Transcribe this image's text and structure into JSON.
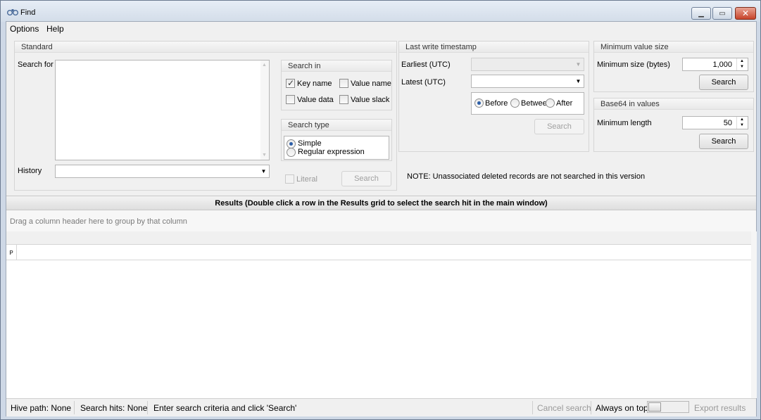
{
  "window": {
    "title": "Find"
  },
  "menu": {
    "items": [
      "Options",
      "Help"
    ]
  },
  "standard": {
    "title": "Standard",
    "search_for_label": "Search for",
    "search_for_value": "",
    "history_label": "History",
    "history_value": "",
    "search_in": {
      "title": "Search in",
      "key_name": {
        "label": "Key name",
        "checked": true
      },
      "value_name": {
        "label": "Value name",
        "checked": false
      },
      "value_data": {
        "label": "Value data",
        "checked": false
      },
      "value_slack": {
        "label": "Value slack",
        "checked": false
      }
    },
    "search_type": {
      "title": "Search type",
      "simple": "Simple",
      "regex": "Regular expression",
      "selected": "Simple"
    },
    "literal_label": "Literal",
    "search_button": "Search"
  },
  "timestamp": {
    "title": "Last write timestamp",
    "earliest_label": "Earliest (UTC)",
    "earliest_value": "",
    "latest_label": "Latest (UTC)",
    "latest_value": "",
    "before": "Before",
    "between": "Betwee",
    "after": "After",
    "selected": "Before",
    "search_button": "Search"
  },
  "min_value": {
    "title": "Minimum value size",
    "label": "Minimum size (bytes)",
    "value": "1,000",
    "search_button": "Search"
  },
  "base64": {
    "title": "Base64 in values",
    "label": "Minimum length",
    "value": "50",
    "search_button": "Search"
  },
  "note": "NOTE: Unassociated deleted records are not searched in this version",
  "results": {
    "header": "Results (Double click a row in the Results grid to select the search hit in the main window)",
    "group_hint": "Drag a column header here to group by that column",
    "row_indicator": "P"
  },
  "status": {
    "hive_path": "Hive path: None",
    "search_hits": "Search hits: None",
    "message": "Enter search criteria and click 'Search'",
    "cancel_search": "Cancel search",
    "always_on_top": "Always on top",
    "export_results": "Export results"
  }
}
